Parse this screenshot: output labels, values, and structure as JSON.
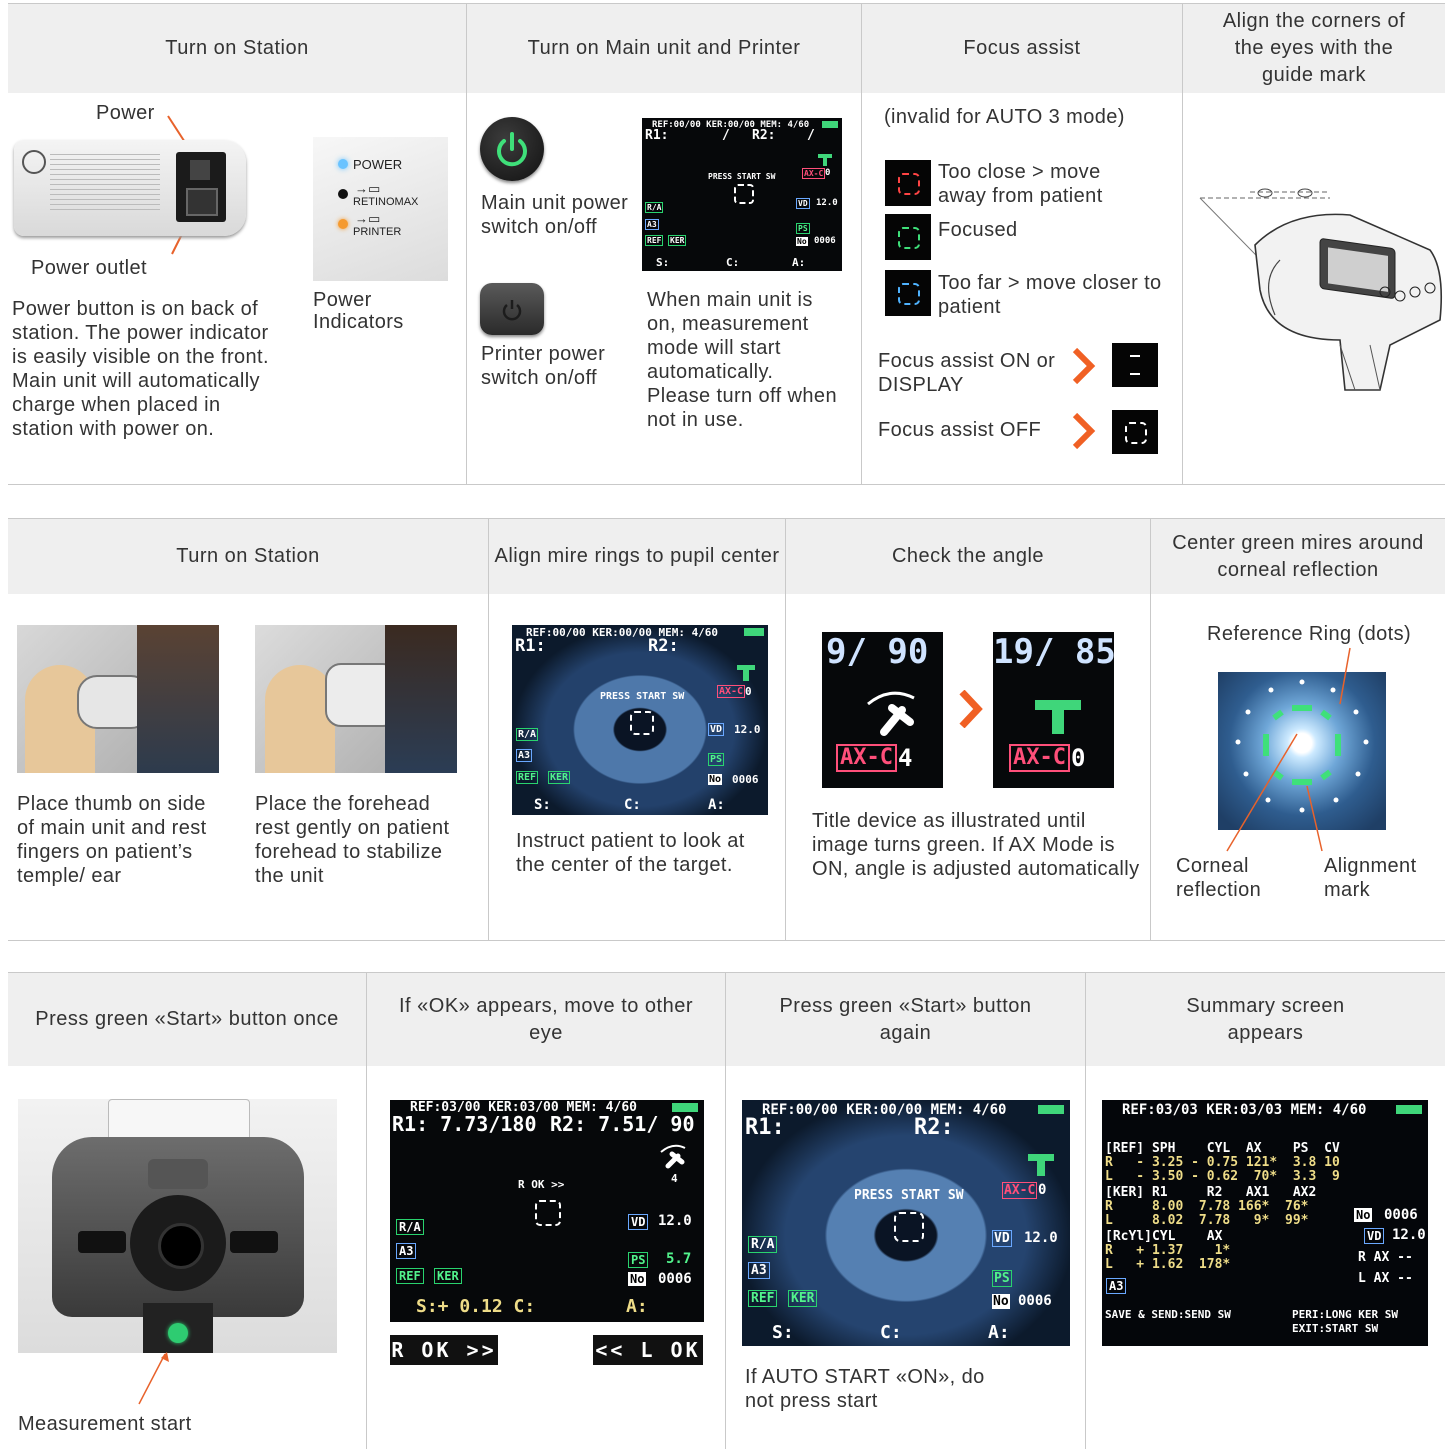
{
  "row1": {
    "headers": [
      "Turn on Station",
      "Turn on Main unit and Printer",
      "Focus assist",
      "Align the corners of the eyes with the guide mark"
    ],
    "station": {
      "power_label": "Power",
      "power_outlet_label": "Power outlet",
      "power_indicators_label": "Power Indicators",
      "indicator_power": "POWER",
      "indicator_retinomax": "RETINOMAX",
      "indicator_printer": "PRINTER",
      "description": "Power button is on back of station. The power indicator is easily visible on the front. Main unit will automatically charge when placed in station with power on."
    },
    "main_unit": {
      "main_switch_label": "Main unit power switch on/off",
      "printer_switch_label": "Printer power switch on/off",
      "description": "When main unit is on, measurement mode will start automatically. Please turn off when not in use.",
      "screen": {
        "top": "REF:00/00 KER:00/00 MEM: 4/60",
        "r1": "R1:",
        "slash1": "/",
        "r2": "R2:",
        "slash2": "/",
        "press": "PRESS START SW",
        "axc": "AX-C",
        "axc_val": "0",
        "vd": "VD",
        "vd_val": "12.0",
        "ra": "R/A",
        "a3": "A3",
        "ref": "REF",
        "ker": "KER",
        "ps": "PS",
        "no": "No",
        "no_val": "0006",
        "s": "S:",
        "c": "C:",
        "a": "A:"
      }
    },
    "focus": {
      "note": "(invalid for AUTO 3 mode)",
      "too_close": "Too close > move away from patient",
      "focused": "Focused",
      "too_far": "Too far > move closer to patient",
      "assist_on": "Focus assist ON or DISPLAY",
      "assist_off": "Focus assist OFF"
    }
  },
  "row2": {
    "headers": [
      "Turn on Station",
      "Align mire rings to pupil center",
      "Check the angle",
      "Center green mires around corneal reflection"
    ],
    "thumb_text": "Place thumb on side of main unit and rest fingers on patient’s temple/ ear",
    "forehead_text": "Place the forehead rest gently on patient forehead to stabilize the unit",
    "instruct_text": "Instruct patient to look at the center of the target.",
    "angle_text": "Title device as illustrated until image turns green. If AX Mode is ON, angle is adjusted automatically",
    "angle_before": {
      "num": "9/ 90",
      "axc": "AX-C",
      "val": "4"
    },
    "angle_after": {
      "num": "19/ 85",
      "axc": "AX-C",
      "val": "0"
    },
    "reference_ring": "Reference Ring (dots)",
    "corneal_reflection": "Corneal reflection",
    "alignment_mark": "Alignment mark",
    "eye_screen": {
      "top": "REF:00/00 KER:00/00 MEM: 4/60",
      "r1": "R1:",
      "r2": "R2:",
      "press": "PRESS START SW",
      "axc": "AX-C",
      "axc_val": "0",
      "vd": "VD",
      "vd_val": "12.0",
      "ra": "R/A",
      "a3": "A3",
      "ref": "REF",
      "ker": "KER",
      "ps": "PS",
      "no": "No",
      "no_val": "0006",
      "s": "S:",
      "c": "C:",
      "a": "A:"
    }
  },
  "row3": {
    "headers": [
      "Press green «Start» button once",
      "If «OK» appears, move to other eye",
      "Press green «Start» button again",
      "Summary screen appears"
    ],
    "measurement_start": "Measurement start",
    "ok_screen": {
      "top": "REF:03/00 KER:03/00 MEM: 4/60",
      "r1": "R1: 7.73/180",
      "r2": "R2: 7.51/ 90",
      "four": "4",
      "rok": "R OK >>",
      "ra": "R/A",
      "a3": "A3",
      "ref": "REF",
      "ker": "KER",
      "vd": "VD",
      "vd_val": "12.0",
      "ps": "PS",
      "ps_val": "5.7",
      "no": "No",
      "no_val": "0006",
      "bottom": "S:+ 0.12 C:",
      "a": "A:"
    },
    "r_ok_bar": "R OK >>",
    "l_ok_bar": "<< L OK",
    "again_screen": {
      "top": "REF:00/00 KER:00/00 MEM: 4/60",
      "r1": "R1:",
      "r2": "R2:",
      "press": "PRESS START SW",
      "axc": "AX-C",
      "axc_val": "0",
      "vd": "VD",
      "vd_val": "12.0",
      "ra": "R/A",
      "a3": "A3",
      "ref": "REF",
      "ker": "KER",
      "ps": "PS",
      "no": "No",
      "no_val": "0006",
      "s": "S:",
      "c": "C:",
      "a": "A:"
    },
    "auto_start": "If AUTO START «ON», do not press start",
    "summary": {
      "top": "REF:03/03 KER:03/03 MEM: 4/60",
      "l1": "[REF] SPH    CYL  AX    PS  CV",
      "l2": "R   - 3.25 - 0.75 121*  3.8 10",
      "l3": "L   - 3.50 - 0.62  70*  3.3  9",
      "l4": "[KER] R1     R2   AX1   AX2",
      "l5": "R     8.00  7.78 166*  76*",
      "l6": "L     8.02  7.78   9*  99*",
      "l7": "[RcYl]CYL    AX",
      "l8": "R   + 1.37    1*",
      "l9": "L   + 1.62  178*",
      "no": "No",
      "no_val": "0006",
      "vd": "VD",
      "vd_val": "12.0",
      "rax": "R AX --",
      "lax": "L AX --",
      "a3": "A3",
      "save": "SAVE & SEND:SEND SW",
      "peri": "PERI:LONG KER SW",
      "exit": "EXIT:START SW"
    }
  }
}
